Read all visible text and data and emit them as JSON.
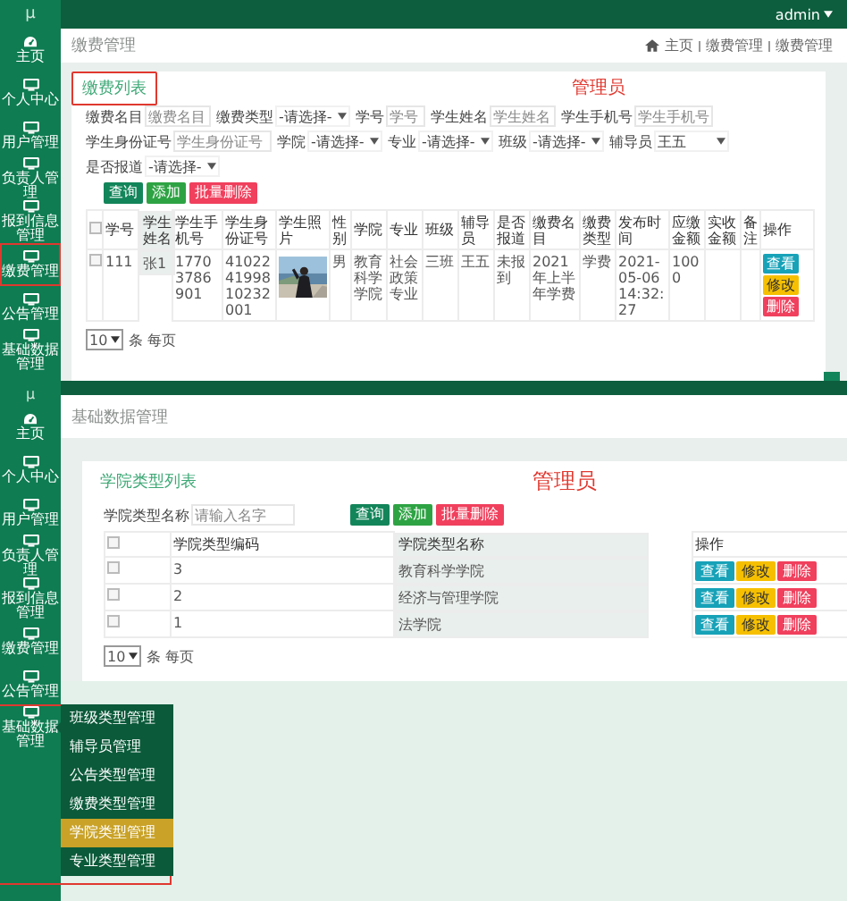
{
  "fee_screen": {
    "logo": "μ",
    "user": "admin",
    "sidebar": [
      {
        "label": "主页",
        "kind": "dashboard",
        "annotated": false
      },
      {
        "label": "个人中心",
        "kind": "monitor",
        "annotated": false
      },
      {
        "label": "用户管理",
        "kind": "monitor",
        "annotated": false
      },
      {
        "label": "负责人管理",
        "kind": "monitor",
        "annotated": false
      },
      {
        "label": "报到信息管理",
        "kind": "monitor",
        "annotated": false
      },
      {
        "label": "缴费管理",
        "kind": "monitor",
        "annotated": true
      },
      {
        "label": "公告管理",
        "kind": "monitor",
        "annotated": false
      },
      {
        "label": "基础数据管理",
        "kind": "monitor",
        "annotated": false
      }
    ],
    "page_title": "缴费管理",
    "breadcrumb": [
      "主页",
      "缴费管理",
      "缴费管理"
    ],
    "card": {
      "title": "缴费列表",
      "title_annotated": true,
      "role_note": "管理员",
      "filter_rows": [
        [
          {
            "label": "缴费名目",
            "kind": "text",
            "placeholder": "缴费名目"
          },
          {
            "label": "缴费类型",
            "kind": "select",
            "value": "-请选择-"
          },
          {
            "label": "学号",
            "kind": "text",
            "placeholder": "学号"
          },
          {
            "label": "学生姓名",
            "kind": "text",
            "placeholder": "学生姓名"
          },
          {
            "label": "学生手机号",
            "kind": "text",
            "placeholder": "学生手机号"
          }
        ],
        [
          {
            "label": "学生身份证号",
            "kind": "text",
            "placeholder": "学生身份证号"
          },
          {
            "label": "学院",
            "kind": "select",
            "value": "-请选择-"
          },
          {
            "label": "专业",
            "kind": "select",
            "value": "-请选择-"
          },
          {
            "label": "班级",
            "kind": "select",
            "value": "-请选择-"
          },
          {
            "label": "辅导员",
            "kind": "select",
            "value": "王五"
          },
          {
            "label": "是否报道",
            "kind": "select",
            "value": "-请选择-"
          }
        ]
      ],
      "buttons": [
        {
          "label": "查询",
          "kind": "query"
        },
        {
          "label": "添加",
          "kind": "add"
        },
        {
          "label": "批量删除",
          "kind": "delete"
        }
      ],
      "table": {
        "columns": [
          {
            "kind": "checkbox",
            "checked": false
          },
          {
            "kind": "text",
            "label": "学号"
          },
          {
            "kind": "text",
            "label": "学生姓名"
          },
          {
            "kind": "text",
            "label": "学生手机号"
          },
          {
            "kind": "text",
            "label": "学生身份证号"
          },
          {
            "label": "学生照片"
          },
          {
            "kind": "text",
            "label": "性别"
          },
          {
            "kind": "text",
            "label": "学院"
          },
          {
            "kind": "text",
            "label": "专业"
          },
          {
            "kind": "text",
            "label": "班级"
          },
          {
            "kind": "text",
            "label": "辅导员"
          },
          {
            "kind": "text",
            "label": "是否报道"
          },
          {
            "kind": "text",
            "label": "缴费名目"
          },
          {
            "kind": "text",
            "label": "缴费类型"
          },
          {
            "kind": "text",
            "label": "发布时间"
          },
          {
            "kind": "text",
            "label": "应缴金额"
          },
          {
            "kind": "text",
            "label": "实收金额"
          },
          {
            "kind": "text",
            "label": "备注"
          },
          {
            "kind": "actions",
            "label": "操作"
          }
        ],
        "rows": [
          {
            "checked": false,
            "cells": [
              null,
              "111",
              "张1",
              "17703786901",
              "410224199810232001",
              null,
              "男",
              "教育科学学院",
              "社会政策专业",
              "三班",
              "王五",
              "未报到",
              "2021年上半年学费",
              "学费",
              "2021-05-06 14:32:27",
              "1000",
              null,
              null,
              null
            ],
            "actions": [
              {
                "label": "查看",
                "kind": "view"
              },
              {
                "label": "修改",
                "kind": "edit"
              },
              {
                "label": "删除",
                "kind": "delete"
              }
            ]
          }
        ]
      },
      "page_size": "10",
      "page_size_label": "条 每页"
    }
  },
  "basic_data_screen": {
    "logo": "μ",
    "sidebar": [
      {
        "label": "主页",
        "kind": "dashboard",
        "annotated": false,
        "expanded": false
      },
      {
        "label": "个人中心",
        "kind": "monitor",
        "annotated": false,
        "expanded": false
      },
      {
        "label": "用户管理",
        "kind": "monitor",
        "annotated": false,
        "expanded": false
      },
      {
        "label": "负责人管理",
        "kind": "monitor",
        "annotated": false,
        "expanded": false
      },
      {
        "label": "报到信息管理",
        "kind": "monitor",
        "annotated": false,
        "expanded": false
      },
      {
        "label": "缴费管理",
        "kind": "monitor",
        "annotated": false,
        "expanded": false
      },
      {
        "label": "公告管理",
        "kind": "monitor",
        "annotated": false,
        "expanded": false
      },
      {
        "label": "基础数据管理",
        "kind": "monitor",
        "annotated": true,
        "expanded": true,
        "children": [
          {
            "label": "班级类型管理",
            "selected": false
          },
          {
            "label": "辅导员管理",
            "selected": false
          },
          {
            "label": "公告类型管理",
            "selected": false
          },
          {
            "label": "缴费类型管理",
            "selected": false
          },
          {
            "label": "学院类型管理",
            "selected": true
          },
          {
            "label": "专业类型管理",
            "selected": false
          }
        ]
      }
    ],
    "page_title": "基础数据管理",
    "card": {
      "title": "学院类型列表",
      "role_note": "管理员",
      "filter": {
        "label": "学院类型名称",
        "kind": "text",
        "placeholder": "请输入名字"
      },
      "buttons": [
        {
          "label": "查询",
          "kind": "query"
        },
        {
          "label": "添加",
          "kind": "add"
        },
        {
          "label": "批量删除",
          "kind": "delete"
        }
      ],
      "table": {
        "columns": [
          {
            "kind": "checkbox",
            "checked": false
          },
          {
            "kind": "text",
            "label": "学院类型编码"
          },
          {
            "kind": "text",
            "label": "学院类型名称"
          },
          {
            "kind": "actions",
            "label": "操作"
          }
        ],
        "rows": [
          {
            "checked": false,
            "cells": [
              null,
              "3",
              "教育科学学院",
              null
            ],
            "actions": [
              {
                "label": "查看",
                "kind": "view"
              },
              {
                "label": "修改",
                "kind": "edit"
              },
              {
                "label": "删除",
                "kind": "delete"
              }
            ]
          },
          {
            "checked": false,
            "cells": [
              null,
              "2",
              "经济与管理学院",
              null
            ],
            "actions": [
              {
                "label": "查看",
                "kind": "view"
              },
              {
                "label": "修改",
                "kind": "edit"
              },
              {
                "label": "删除",
                "kind": "delete"
              }
            ]
          },
          {
            "checked": false,
            "cells": [
              null,
              "1",
              "法学院",
              null
            ],
            "actions": [
              {
                "label": "查看",
                "kind": "view"
              },
              {
                "label": "修改",
                "kind": "edit"
              },
              {
                "label": "删除",
                "kind": "delete"
              }
            ]
          }
        ]
      },
      "page_size": "10",
      "page_size_label": "条 每页"
    }
  }
}
